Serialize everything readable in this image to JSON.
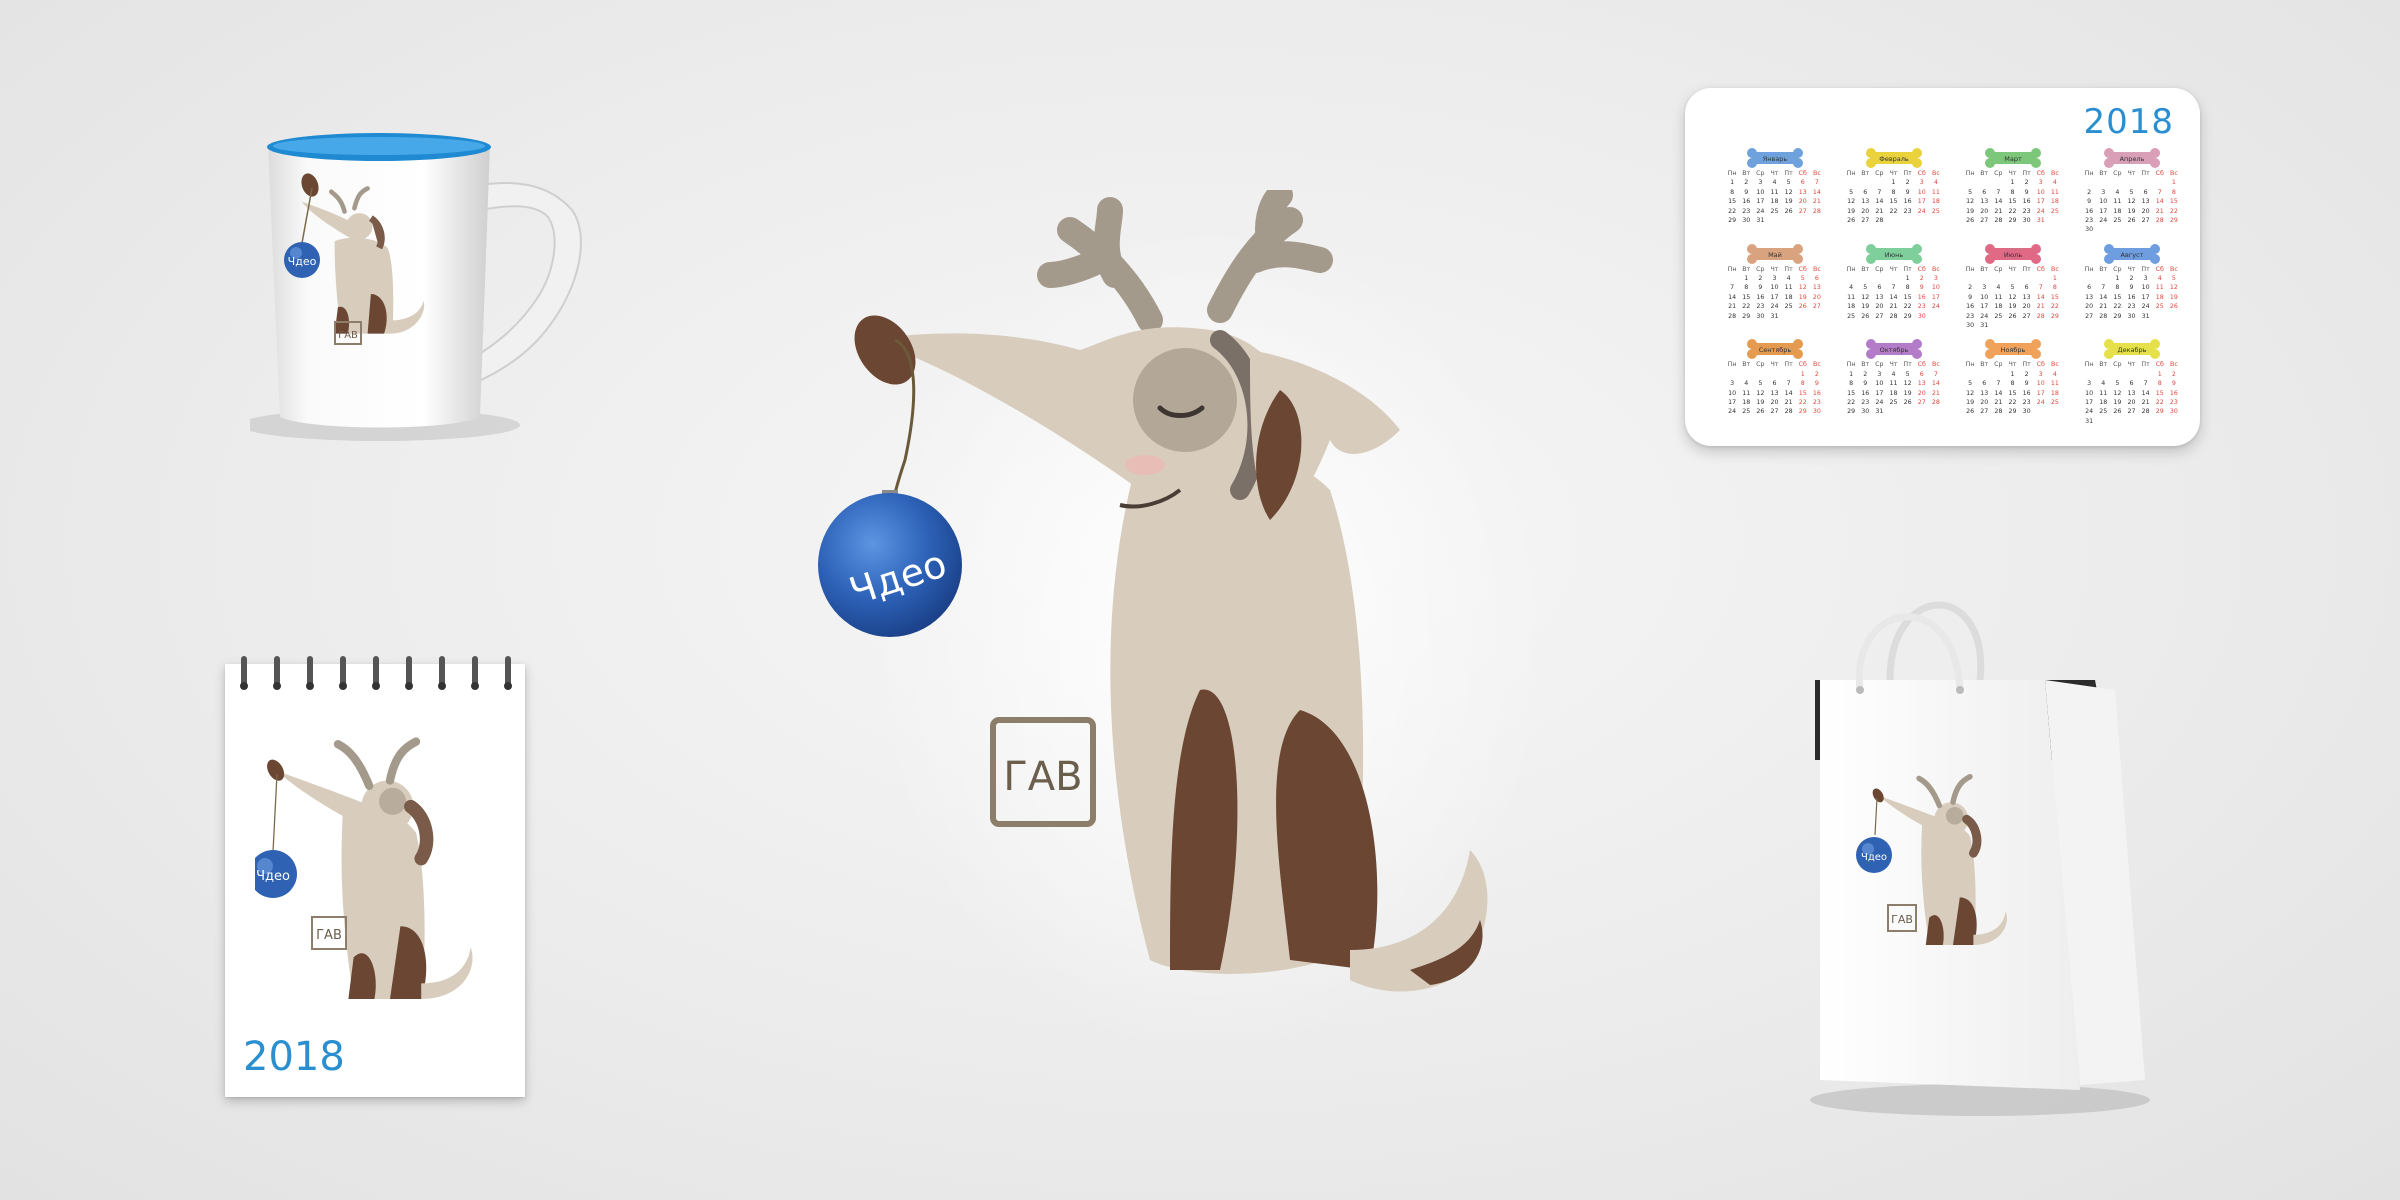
{
  "bauble_text": "Чдео",
  "gav_text": "ГАВ",
  "calendar": {
    "year": "2018",
    "weekday_headers": [
      "Пн",
      "Вт",
      "Ср",
      "Чт",
      "Пт",
      "Сб",
      "Вс"
    ],
    "bone_colors": [
      "#6fa2dc",
      "#e9d23c",
      "#7cc77a",
      "#d99fb7",
      "#d9a37f",
      "#7fcf9c",
      "#e06a86",
      "#6f9ee0",
      "#e59b4f",
      "#b47bc8",
      "#f0a25a",
      "#e6e04a"
    ],
    "months": [
      {
        "name": "Январь"
      },
      {
        "name": "Февраль"
      },
      {
        "name": "Март"
      },
      {
        "name": "Апрель"
      },
      {
        "name": "Май"
      },
      {
        "name": "Июнь"
      },
      {
        "name": "Июль"
      },
      {
        "name": "Август"
      },
      {
        "name": "Сентябрь"
      },
      {
        "name": "Октябрь"
      },
      {
        "name": "Ноябрь"
      },
      {
        "name": "Декабрь"
      }
    ]
  },
  "notepad": {
    "year": "2018"
  },
  "colors": {
    "accent_blue": "#2a8fd0",
    "dog_fur": "#d8cdbd",
    "dog_spots": "#6b4632",
    "antlers": "#a49a8b",
    "mug_rim": "#1f8ad1"
  }
}
